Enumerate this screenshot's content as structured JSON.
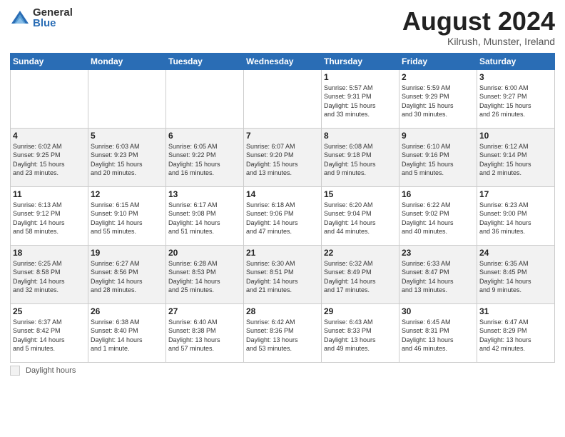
{
  "header": {
    "logo_general": "General",
    "logo_blue": "Blue",
    "month_title": "August 2024",
    "subtitle": "Kilrush, Munster, Ireland"
  },
  "weekdays": [
    "Sunday",
    "Monday",
    "Tuesday",
    "Wednesday",
    "Thursday",
    "Friday",
    "Saturday"
  ],
  "footer": {
    "daylight_label": "Daylight hours"
  },
  "weeks": [
    [
      {
        "day": "",
        "info": ""
      },
      {
        "day": "",
        "info": ""
      },
      {
        "day": "",
        "info": ""
      },
      {
        "day": "",
        "info": ""
      },
      {
        "day": "1",
        "info": "Sunrise: 5:57 AM\nSunset: 9:31 PM\nDaylight: 15 hours\nand 33 minutes."
      },
      {
        "day": "2",
        "info": "Sunrise: 5:59 AM\nSunset: 9:29 PM\nDaylight: 15 hours\nand 30 minutes."
      },
      {
        "day": "3",
        "info": "Sunrise: 6:00 AM\nSunset: 9:27 PM\nDaylight: 15 hours\nand 26 minutes."
      }
    ],
    [
      {
        "day": "4",
        "info": "Sunrise: 6:02 AM\nSunset: 9:25 PM\nDaylight: 15 hours\nand 23 minutes."
      },
      {
        "day": "5",
        "info": "Sunrise: 6:03 AM\nSunset: 9:23 PM\nDaylight: 15 hours\nand 20 minutes."
      },
      {
        "day": "6",
        "info": "Sunrise: 6:05 AM\nSunset: 9:22 PM\nDaylight: 15 hours\nand 16 minutes."
      },
      {
        "day": "7",
        "info": "Sunrise: 6:07 AM\nSunset: 9:20 PM\nDaylight: 15 hours\nand 13 minutes."
      },
      {
        "day": "8",
        "info": "Sunrise: 6:08 AM\nSunset: 9:18 PM\nDaylight: 15 hours\nand 9 minutes."
      },
      {
        "day": "9",
        "info": "Sunrise: 6:10 AM\nSunset: 9:16 PM\nDaylight: 15 hours\nand 5 minutes."
      },
      {
        "day": "10",
        "info": "Sunrise: 6:12 AM\nSunset: 9:14 PM\nDaylight: 15 hours\nand 2 minutes."
      }
    ],
    [
      {
        "day": "11",
        "info": "Sunrise: 6:13 AM\nSunset: 9:12 PM\nDaylight: 14 hours\nand 58 minutes."
      },
      {
        "day": "12",
        "info": "Sunrise: 6:15 AM\nSunset: 9:10 PM\nDaylight: 14 hours\nand 55 minutes."
      },
      {
        "day": "13",
        "info": "Sunrise: 6:17 AM\nSunset: 9:08 PM\nDaylight: 14 hours\nand 51 minutes."
      },
      {
        "day": "14",
        "info": "Sunrise: 6:18 AM\nSunset: 9:06 PM\nDaylight: 14 hours\nand 47 minutes."
      },
      {
        "day": "15",
        "info": "Sunrise: 6:20 AM\nSunset: 9:04 PM\nDaylight: 14 hours\nand 44 minutes."
      },
      {
        "day": "16",
        "info": "Sunrise: 6:22 AM\nSunset: 9:02 PM\nDaylight: 14 hours\nand 40 minutes."
      },
      {
        "day": "17",
        "info": "Sunrise: 6:23 AM\nSunset: 9:00 PM\nDaylight: 14 hours\nand 36 minutes."
      }
    ],
    [
      {
        "day": "18",
        "info": "Sunrise: 6:25 AM\nSunset: 8:58 PM\nDaylight: 14 hours\nand 32 minutes."
      },
      {
        "day": "19",
        "info": "Sunrise: 6:27 AM\nSunset: 8:56 PM\nDaylight: 14 hours\nand 28 minutes."
      },
      {
        "day": "20",
        "info": "Sunrise: 6:28 AM\nSunset: 8:53 PM\nDaylight: 14 hours\nand 25 minutes."
      },
      {
        "day": "21",
        "info": "Sunrise: 6:30 AM\nSunset: 8:51 PM\nDaylight: 14 hours\nand 21 minutes."
      },
      {
        "day": "22",
        "info": "Sunrise: 6:32 AM\nSunset: 8:49 PM\nDaylight: 14 hours\nand 17 minutes."
      },
      {
        "day": "23",
        "info": "Sunrise: 6:33 AM\nSunset: 8:47 PM\nDaylight: 14 hours\nand 13 minutes."
      },
      {
        "day": "24",
        "info": "Sunrise: 6:35 AM\nSunset: 8:45 PM\nDaylight: 14 hours\nand 9 minutes."
      }
    ],
    [
      {
        "day": "25",
        "info": "Sunrise: 6:37 AM\nSunset: 8:42 PM\nDaylight: 14 hours\nand 5 minutes."
      },
      {
        "day": "26",
        "info": "Sunrise: 6:38 AM\nSunset: 8:40 PM\nDaylight: 14 hours\nand 1 minute."
      },
      {
        "day": "27",
        "info": "Sunrise: 6:40 AM\nSunset: 8:38 PM\nDaylight: 13 hours\nand 57 minutes."
      },
      {
        "day": "28",
        "info": "Sunrise: 6:42 AM\nSunset: 8:36 PM\nDaylight: 13 hours\nand 53 minutes."
      },
      {
        "day": "29",
        "info": "Sunrise: 6:43 AM\nSunset: 8:33 PM\nDaylight: 13 hours\nand 49 minutes."
      },
      {
        "day": "30",
        "info": "Sunrise: 6:45 AM\nSunset: 8:31 PM\nDaylight: 13 hours\nand 46 minutes."
      },
      {
        "day": "31",
        "info": "Sunrise: 6:47 AM\nSunset: 8:29 PM\nDaylight: 13 hours\nand 42 minutes."
      }
    ]
  ]
}
